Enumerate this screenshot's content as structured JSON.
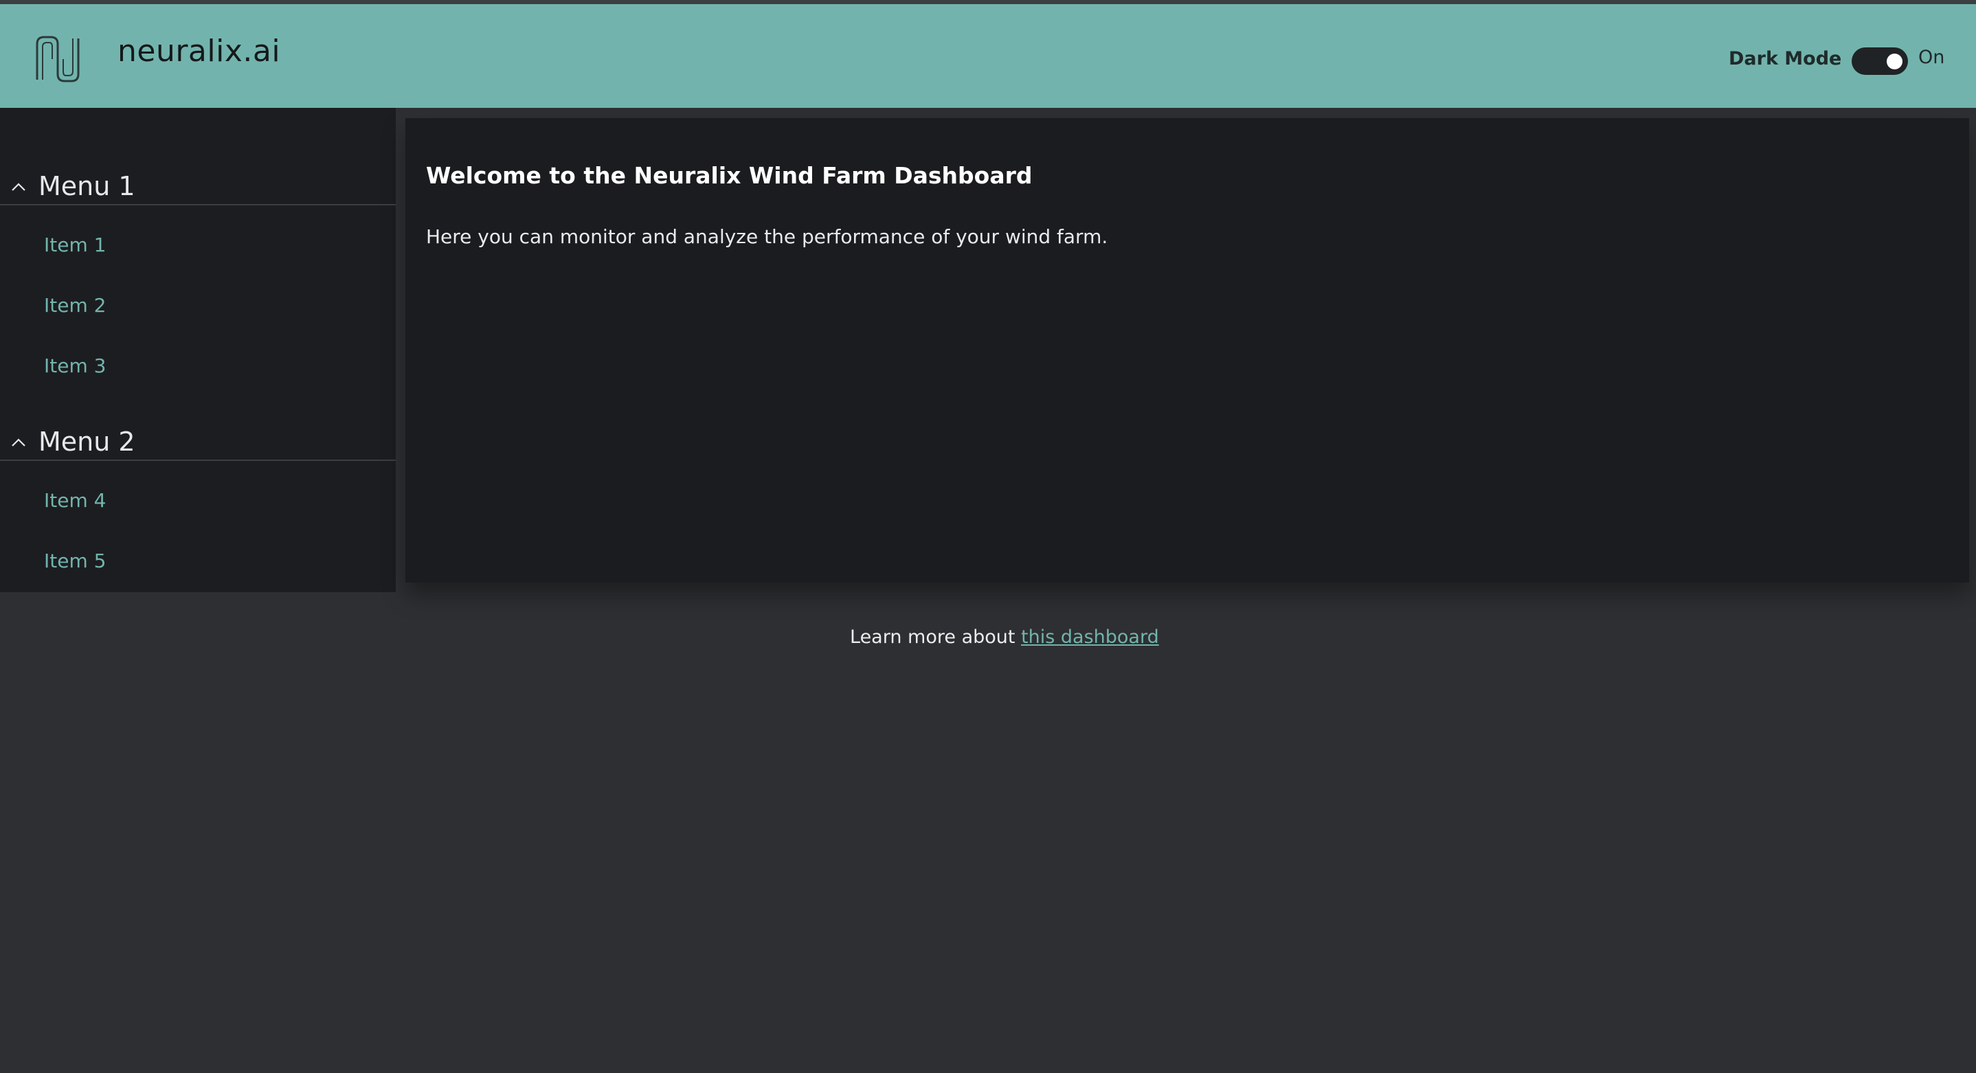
{
  "header": {
    "brand": "neuralix.ai",
    "dark_mode_label": "Dark Mode",
    "dark_mode_state": "On",
    "accent_color": "#72b4ad"
  },
  "sidebar": {
    "menus": [
      {
        "label": "Menu 1",
        "expanded": true,
        "items": [
          {
            "label": "Item 1"
          },
          {
            "label": "Item 2"
          },
          {
            "label": "Item 3"
          }
        ]
      },
      {
        "label": "Menu 2",
        "expanded": true,
        "items": [
          {
            "label": "Item 4"
          },
          {
            "label": "Item 5"
          }
        ]
      }
    ]
  },
  "main": {
    "title": "Welcome to the Neuralix Wind Farm Dashboard",
    "description": "Here you can monitor and analyze the performance of your wind farm."
  },
  "footer": {
    "prefix": "Learn more about ",
    "link_text": "this dashboard"
  }
}
